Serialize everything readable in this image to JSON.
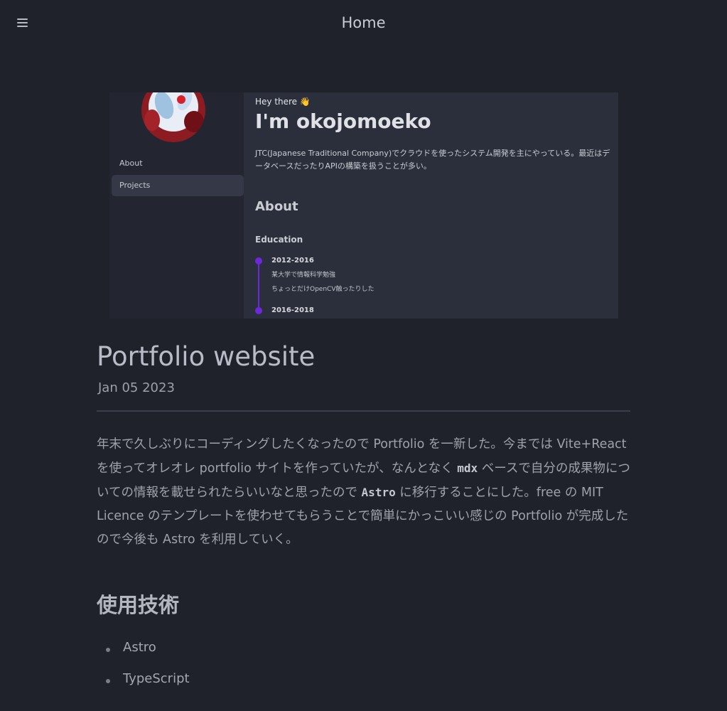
{
  "header": {
    "title": "Home",
    "menu_icon": "hamburger-menu-icon"
  },
  "preview": {
    "sidebar": {
      "items": [
        {
          "label": "About"
        },
        {
          "label": "Projects"
        }
      ]
    },
    "greeting": "Hey there 👋",
    "name": "I'm okojomoeko",
    "intro": "JTC(Japanese Traditional Company)でクラウドを使ったシステム開発を主にやっている。最近はデータベースだったりAPIの構築を扱うことが多い。",
    "about_heading": "About",
    "education_heading": "Education",
    "timeline": [
      {
        "years": "2012-2016",
        "title": "某大学で情報科学勉強",
        "detail": "ちょっとだけOpenCV触ったりした"
      },
      {
        "years": "2016-2018"
      }
    ]
  },
  "post": {
    "title": "Portfolio website",
    "date": "Jan 05 2023",
    "body": {
      "p1": "年末で久しぶりにコーディングしたくなったので Portfolio を一新した。今までは Vite+React を使ってオレオレ portfolio サイトを作っていたが、なんとなく ",
      "code1": "mdx",
      "p2": " ベースで自分の成果物についての情報を載せられたらいいなと思ったので ",
      "code2": "Astro",
      "p3": " に移行することにした。free の MIT Licence のテンプレートを使わせてもらうことで簡単にかっこいい感じの Portfolio が完成したので今後も Astro を利用していく。"
    },
    "tech_heading": "使用技術",
    "tech_list": [
      "Astro",
      "TypeScript"
    ]
  },
  "colors": {
    "background": "#1f222b",
    "accent": "#6d29d9"
  }
}
